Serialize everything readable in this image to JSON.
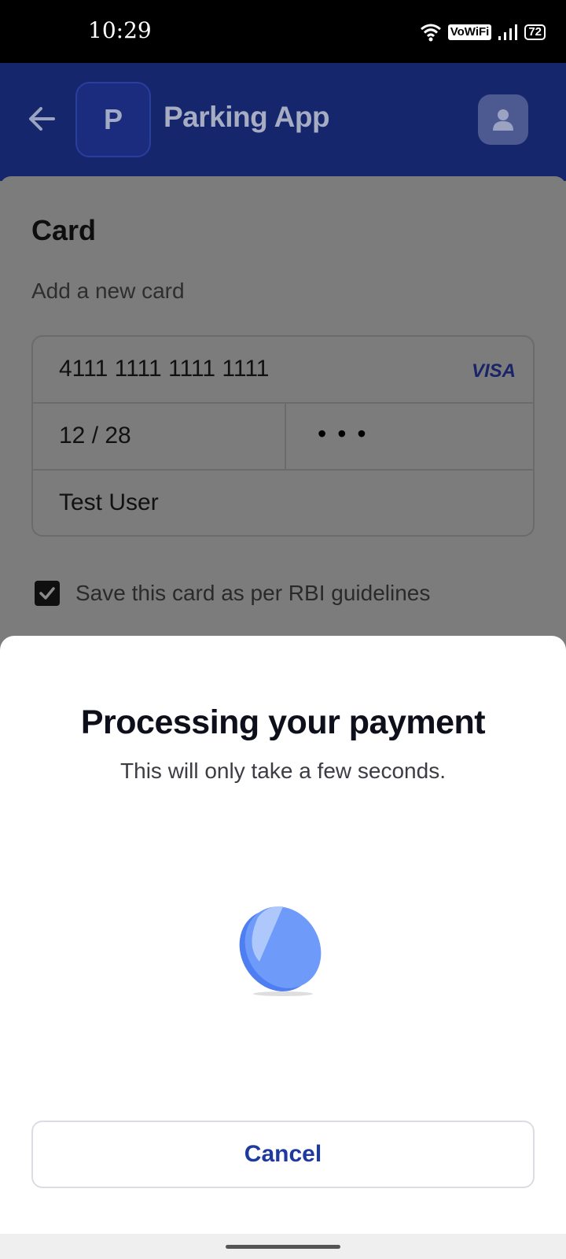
{
  "status_bar": {
    "time": "10:29",
    "vowifi": "VoWiFi",
    "battery": "72",
    "icons": [
      "wifi-icon",
      "signal-icon",
      "battery-icon"
    ]
  },
  "header": {
    "logo_letter": "P",
    "title": "Parking App",
    "icons": [
      "back-arrow-icon",
      "user-icon"
    ],
    "background": "#16266d"
  },
  "card_form": {
    "heading": "Card",
    "subheading": "Add a new card",
    "card_number": "4111 1111 1111 1111",
    "brand": "VISA",
    "expiry": "12 / 28",
    "cvv_masked": "•••",
    "name": "Test User",
    "save_label": "Save this card as per RBI guidelines",
    "save_checked": true
  },
  "sheet": {
    "title": "Processing your payment",
    "subtitle": "This will only take a few seconds.",
    "cancel_label": "Cancel",
    "accent": "#1e3a9e",
    "spinner_icon": "coin-spinner-icon"
  }
}
